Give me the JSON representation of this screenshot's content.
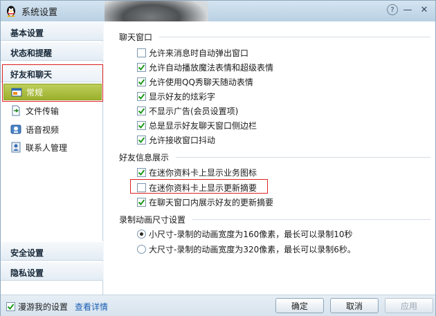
{
  "window": {
    "title": "系统设置"
  },
  "sidebar": {
    "categories": [
      {
        "label": "基本设置"
      },
      {
        "label": "状态和提醒"
      },
      {
        "label": "好友和聊天"
      },
      {
        "label": "安全设置"
      },
      {
        "label": "隐私设置"
      }
    ],
    "items": [
      {
        "label": "常规",
        "icon": "general-settings-icon",
        "selected": true
      },
      {
        "label": "文件传输",
        "icon": "file-transfer-icon"
      },
      {
        "label": "语音视频",
        "icon": "voice-video-icon"
      },
      {
        "label": "联系人管理",
        "icon": "contact-management-icon"
      }
    ]
  },
  "main": {
    "sections": [
      {
        "title": "聊天窗口",
        "options": [
          {
            "label": "允许来消息时自动弹出窗口",
            "checked": false
          },
          {
            "label": "允许自动播放魔法表情和超级表情",
            "checked": true
          },
          {
            "label": "允许使用QQ秀聊天随动表情",
            "checked": true
          },
          {
            "label": "显示好友的炫彩字",
            "checked": true
          },
          {
            "label": "不显示广告(会员设置项)",
            "checked": true
          },
          {
            "label": "总是显示好友聊天窗口侧边栏",
            "checked": true
          },
          {
            "label": "允许接收窗口抖动",
            "checked": true
          }
        ]
      },
      {
        "title": "好友信息展示",
        "options": [
          {
            "label": "在迷你资料卡上显示业务图标",
            "checked": true
          },
          {
            "label": "在迷你资料卡上显示更新摘要",
            "checked": false
          },
          {
            "label": "在聊天窗口内展示好友的更新摘要",
            "checked": true
          }
        ]
      },
      {
        "title": "录制动画尺寸设置",
        "radios": [
          {
            "label": "小尺寸-录制的动画宽度为160像素，最长可以录制10秒",
            "selected": true
          },
          {
            "label": "大尺寸-录制的动画宽度为320像素，最长可以录制6秒。",
            "selected": false
          }
        ]
      }
    ]
  },
  "footer": {
    "roam_label": "漫游我的设置",
    "roam_checked": true,
    "details_link": "查看详情",
    "ok_label": "确定",
    "cancel_label": "取消",
    "apply_label": "应用"
  },
  "colors": {
    "selected_item": "#9bb02c",
    "highlight_border": "#e02020",
    "link": "#1a5fb4"
  }
}
